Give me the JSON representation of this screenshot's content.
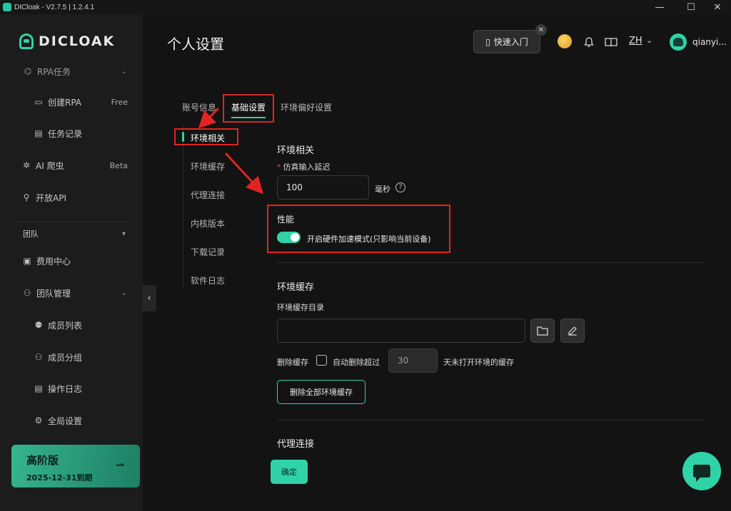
{
  "window": {
    "title": "DICloak - V2.7.5 | 1.2.4.1",
    "minimize": "—",
    "maximize": "☐",
    "close": "✕"
  },
  "sidebar": {
    "brand": "DICLOAK",
    "items": [
      {
        "label": "RPA任务",
        "icon": "robot-icon",
        "chevron": "⌄"
      },
      {
        "label": "创建RPA",
        "icon": "create-rpa-icon",
        "tag": "Free"
      },
      {
        "label": "任务记录",
        "icon": "task-record-icon"
      },
      {
        "label": "AI 爬虫",
        "icon": "ai-crawler-icon",
        "tag": "Beta"
      },
      {
        "label": "开放API",
        "icon": "api-icon"
      },
      {
        "label": "团队",
        "chevron": "▾"
      },
      {
        "label": "费用中心",
        "icon": "billing-icon"
      },
      {
        "label": "团队管理",
        "icon": "team-icon",
        "chevron": "⌄"
      },
      {
        "label": "成员列表",
        "icon": "member-list-icon"
      },
      {
        "label": "成员分组",
        "icon": "member-group-icon"
      },
      {
        "label": "操作日志",
        "icon": "operation-log-icon"
      },
      {
        "label": "全局设置",
        "icon": "global-settings-icon"
      }
    ],
    "plan": {
      "name": "高阶版",
      "expiry": "2025-12-31到期",
      "arrow": "⇀"
    },
    "collapse": "‹"
  },
  "header": {
    "page_title": "个人设置",
    "quickstart_label": "快速入门",
    "quickstart_close": "✕",
    "language": "ZH",
    "language_chevron": "⌄",
    "username": "qianyi..."
  },
  "tabs": [
    {
      "label": "账号信息",
      "active": false
    },
    {
      "label": "基础设置",
      "active": true
    },
    {
      "label": "环境偏好设置",
      "active": false
    }
  ],
  "subnav": [
    {
      "label": "环境相关",
      "active": true
    },
    {
      "label": "环境缓存"
    },
    {
      "label": "代理连接"
    },
    {
      "label": "内核版本"
    },
    {
      "label": "下载记录"
    },
    {
      "label": "软件日志"
    }
  ],
  "env_section": {
    "title": "环境相关",
    "delay_label": "仿真输入延迟",
    "required_mark": "*",
    "delay_value": "100",
    "delay_unit": "毫秒",
    "help": "?"
  },
  "performance": {
    "title": "性能",
    "toggle_on": true,
    "toggle_label": "开启硬件加速模式(只影响当前设备)"
  },
  "cache_section": {
    "title": "环境缓存",
    "dir_label": "环境缓存目录",
    "dir_value": "",
    "delete_label": "删除缓存",
    "auto_delete_label": "自动删除超过",
    "days_value": "30",
    "days_suffix": "天未打开环境的缓存",
    "clear_all_button": "删除全部环境缓存"
  },
  "proxy_section": {
    "title": "代理连接"
  },
  "confirm_button": "确定",
  "colors": {
    "accent": "#2fd3a7",
    "annotation": "#e02424",
    "background": "#131313",
    "sidebar": "#1c1c1c"
  }
}
